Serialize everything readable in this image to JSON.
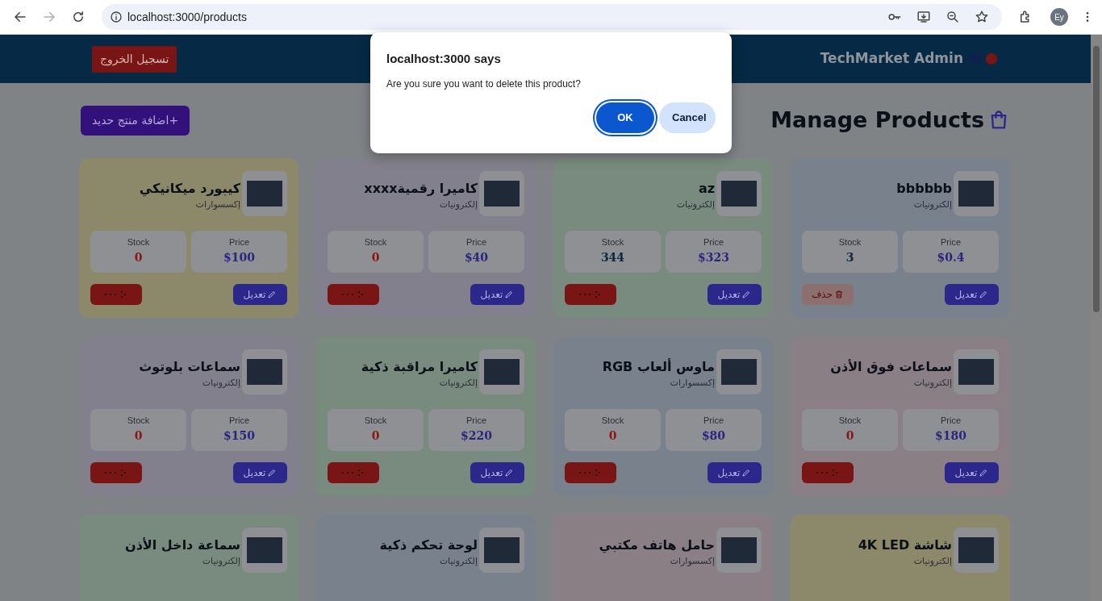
{
  "browser": {
    "forward_disabled": true,
    "url": "localhost:3000/products",
    "profile": "Ey"
  },
  "header": {
    "brand": "TechMarket Admin",
    "logout": "تسجيل الخروج"
  },
  "page": {
    "title": "Manage Products",
    "add_button": "+اضافة منتج حديد"
  },
  "products": [
    {
      "name": "bbbbbb",
      "category": "إلكترونيات",
      "color": "#78818c",
      "price_label": "Price",
      "price": "$0.4",
      "stock_label": "Stock",
      "stock": "3",
      "in_stock": true,
      "edit": "تعديل",
      "delete": {
        "kind": "light",
        "label": "حذف"
      }
    },
    {
      "name": "az",
      "category": "إلكترونيات",
      "color": "#798b7f",
      "price_label": "Price",
      "price": "$323",
      "stock_label": "Stock",
      "stock": "344",
      "in_stock": true,
      "edit": "تعديل",
      "delete": {
        "kind": "solid"
      }
    },
    {
      "name": "كاميرا رقميةxxxx",
      "category": "إلكترونيات",
      "color": "#82808c",
      "price_label": "Price",
      "price": "$40",
      "stock_label": "Stock",
      "stock": "0",
      "in_stock": false,
      "edit": "تعديل",
      "delete": {
        "kind": "solid"
      }
    },
    {
      "name": "كيبورد ميكانيكي",
      "category": "إكسسوارات",
      "color": "#8c896b",
      "price_label": "Price",
      "price": "$100",
      "stock_label": "Stock",
      "stock": "0",
      "in_stock": false,
      "edit": "تعديل",
      "delete": {
        "kind": "solid"
      }
    },
    {
      "name": "سماعات فوق الأذن",
      "category": "إلكترونيات",
      "color": "#8b7f86",
      "price_label": "Price",
      "price": "$180",
      "stock_label": "Stock",
      "stock": "0",
      "in_stock": false,
      "edit": "تعديل",
      "delete": {
        "kind": "solid"
      }
    },
    {
      "name": "ماوس ألعاب RGB",
      "category": "إكسسوارات",
      "color": "#78818c",
      "price_label": "Price",
      "price": "$80",
      "stock_label": "Stock",
      "stock": "0",
      "in_stock": false,
      "edit": "تعديل",
      "delete": {
        "kind": "solid"
      }
    },
    {
      "name": "كاميرا مراقبة ذكية",
      "category": "إلكترونيات",
      "color": "#798b7f",
      "price_label": "Price",
      "price": "$220",
      "stock_label": "Stock",
      "stock": "0",
      "in_stock": false,
      "edit": "تعديل",
      "delete": {
        "kind": "solid"
      }
    },
    {
      "name": "سماعات بلوتوث",
      "category": "إلكترونيات",
      "color": "#82808c",
      "price_label": "Price",
      "price": "$150",
      "stock_label": "Stock",
      "stock": "0",
      "in_stock": false,
      "edit": "تعديل",
      "delete": {
        "kind": "solid"
      }
    },
    {
      "name": "شاشة 4K LED",
      "category": "إلكترونيات",
      "color": "#8c896b"
    },
    {
      "name": "حامل هاتف مكتبي",
      "category": "إكسسوارات",
      "color": "#8b7f86"
    },
    {
      "name": "لوحة تحكم ذكية",
      "category": "إلكترونيات",
      "color": "#78818c"
    },
    {
      "name": "سماعة داخل الأذن",
      "category": "إلكترونيات",
      "color": "#798b7f"
    }
  ],
  "dialog": {
    "title": "localhost:3000 says",
    "message": "Are you sure you want to delete this product?",
    "buttons": [
      {
        "label": "Cancel",
        "kind": "secondary",
        "focused": false
      },
      {
        "label": "OK",
        "kind": "primary",
        "focused": true
      }
    ]
  }
}
